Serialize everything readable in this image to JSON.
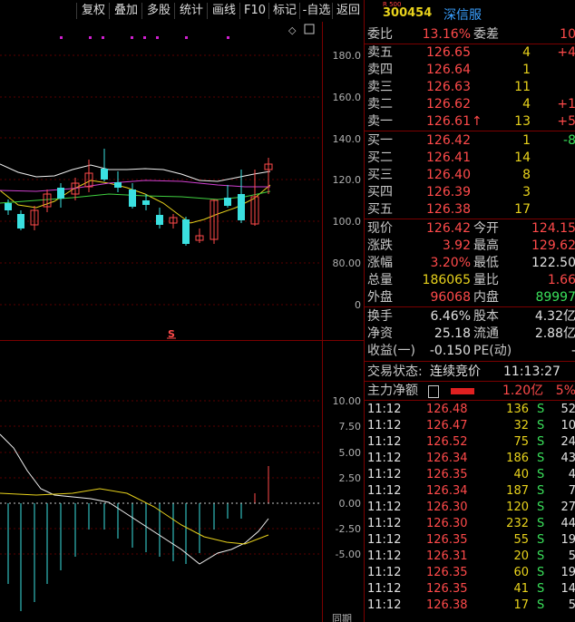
{
  "toolbar": {
    "buttons": [
      "复权",
      "叠加",
      "多股",
      "统计",
      "画线",
      "F10",
      "标记",
      "-自选",
      "返回"
    ]
  },
  "chart": {
    "price_ticks": [
      "180.0",
      "160.0",
      "140.0",
      "120.0",
      "100.0",
      "80.00",
      "0"
    ],
    "macd_ticks": [
      "10.00",
      "7.50",
      "5.00",
      "2.50",
      "0.00",
      "-2.50",
      "-5.00"
    ],
    "marker": "S",
    "bottom_label": "同期"
  },
  "colors": {
    "up": "#ff4a4a",
    "down": "#3ae0e0",
    "text_label": "#c8c8c8",
    "code": "#e8d21c",
    "name": "#3aa0ff",
    "border": "#7a0000"
  },
  "quote": {
    "badge": "R 500",
    "code": "300454",
    "name": "深信服",
    "weibi_label": "委比",
    "weibi_value": "13.16%",
    "weicha_label": "委差",
    "weicha_value": "10",
    "asks": [
      {
        "label": "卖五",
        "price": "126.65",
        "vol": "4",
        "chg": "+4"
      },
      {
        "label": "卖四",
        "price": "126.64",
        "vol": "1",
        "chg": ""
      },
      {
        "label": "卖三",
        "price": "126.63",
        "vol": "11",
        "chg": ""
      },
      {
        "label": "卖二",
        "price": "126.62",
        "vol": "4",
        "chg": "+1"
      },
      {
        "label": "卖一",
        "price": "126.61",
        "vol": "13",
        "chg": "+5",
        "arrow": "↑"
      }
    ],
    "bids": [
      {
        "label": "买一",
        "price": "126.42",
        "vol": "1",
        "chg": "-8"
      },
      {
        "label": "买二",
        "price": "126.41",
        "vol": "14",
        "chg": ""
      },
      {
        "label": "买三",
        "price": "126.40",
        "vol": "8",
        "chg": ""
      },
      {
        "label": "买四",
        "price": "126.39",
        "vol": "3",
        "chg": ""
      },
      {
        "label": "买五",
        "price": "126.38",
        "vol": "17",
        "chg": ""
      }
    ],
    "stats": [
      {
        "l1": "现价",
        "v1": "126.42",
        "l2": "今开",
        "v2": "124.15"
      },
      {
        "l1": "涨跌",
        "v1": "3.92",
        "l2": "最高",
        "v2": "129.62"
      },
      {
        "l1": "涨幅",
        "v1": "3.20%",
        "l2": "最低",
        "v2": "122.50"
      },
      {
        "l1": "总量",
        "v1": "186065",
        "l2": "量比",
        "v2": "1.66"
      },
      {
        "l1": "外盘",
        "v1": "96068",
        "l2": "内盘",
        "v2": "89997"
      }
    ],
    "fin": [
      {
        "l1": "换手",
        "v1": "6.46%",
        "l2": "股本",
        "v2": "4.32亿"
      },
      {
        "l1": "净资",
        "v1": "25.18",
        "l2": "流通",
        "v2": "2.88亿"
      },
      {
        "l1": "收益(一)",
        "v1": "-0.150",
        "l2": "PE(动)",
        "v2": "-"
      }
    ],
    "trade_status_label": "交易状态:",
    "trade_status_value": "连续竞价",
    "trade_time": "11:13:27",
    "main_flow_label": "主力净额",
    "main_flow_value": "1.20亿",
    "main_flow_pct": "5%"
  },
  "ticks": [
    {
      "time": "11:12",
      "price": "126.48",
      "vol": "136",
      "side": "S",
      "n": "52"
    },
    {
      "time": "11:12",
      "price": "126.47",
      "vol": "32",
      "side": "S",
      "n": "10"
    },
    {
      "time": "11:12",
      "price": "126.52",
      "vol": "75",
      "side": "S",
      "n": "24"
    },
    {
      "time": "11:12",
      "price": "126.34",
      "vol": "186",
      "side": "S",
      "n": "43"
    },
    {
      "time": "11:12",
      "price": "126.35",
      "vol": "40",
      "side": "S",
      "n": "4"
    },
    {
      "time": "11:12",
      "price": "126.34",
      "vol": "187",
      "side": "S",
      "n": "7"
    },
    {
      "time": "11:12",
      "price": "126.30",
      "vol": "120",
      "side": "S",
      "n": "27"
    },
    {
      "time": "11:12",
      "price": "126.30",
      "vol": "232",
      "side": "S",
      "n": "44"
    },
    {
      "time": "11:12",
      "price": "126.35",
      "vol": "55",
      "side": "S",
      "n": "19"
    },
    {
      "time": "11:12",
      "price": "126.31",
      "vol": "20",
      "side": "S",
      "n": "5"
    },
    {
      "time": "11:12",
      "price": "126.35",
      "vol": "60",
      "side": "S",
      "n": "19"
    },
    {
      "time": "11:12",
      "price": "126.35",
      "vol": "41",
      "side": "S",
      "n": "14"
    },
    {
      "time": "11:12",
      "price": "126.38",
      "vol": "17",
      "side": "S",
      "n": "5"
    }
  ]
}
